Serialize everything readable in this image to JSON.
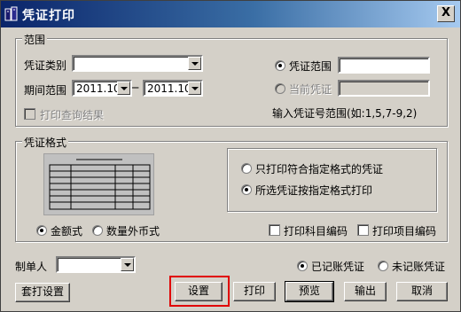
{
  "window": {
    "title": "凭证打印",
    "close_label": "X"
  },
  "range_group": {
    "legend": "范围",
    "voucher_type_label": "凭证类别",
    "voucher_type_value": "",
    "period_label": "期间范围",
    "period_from": "2011.10",
    "period_separator": "─",
    "period_to": "2011.10",
    "print_query_result_label": "打印查询结果",
    "voucher_range_label": "凭证范围",
    "voucher_range_value": "",
    "current_voucher_label": "当前凭证",
    "current_voucher_value": "",
    "hint": "输入凭证号范围(如:1,5,7-9,2)"
  },
  "format_group": {
    "legend": "凭证格式",
    "amount_format_label": "金额式",
    "foreign_qty_format_label": "数量外币式",
    "only_matching_label": "只打印符合指定格式的凭证",
    "all_selected_label": "所选凭证按指定格式打印",
    "print_account_code_label": "打印科目编码",
    "print_item_code_label": "打印项目编码"
  },
  "maker": {
    "label": "制单人",
    "value": ""
  },
  "posting": {
    "posted_label": "已记账凭证",
    "unposted_label": "未记账凭证"
  },
  "buttons": {
    "overlay_setup": "套打设置",
    "settings": "设置",
    "print": "打印",
    "preview": "预览",
    "export": "输出",
    "cancel": "取消"
  },
  "state": {
    "voucher_range_selected": true,
    "amount_format_selected": true,
    "all_selected_format_selected": true,
    "posted_selected": true
  },
  "colors": {
    "highlight": "#e00000",
    "titlebar_start": "#0a246a",
    "titlebar_end": "#a6caf0"
  }
}
